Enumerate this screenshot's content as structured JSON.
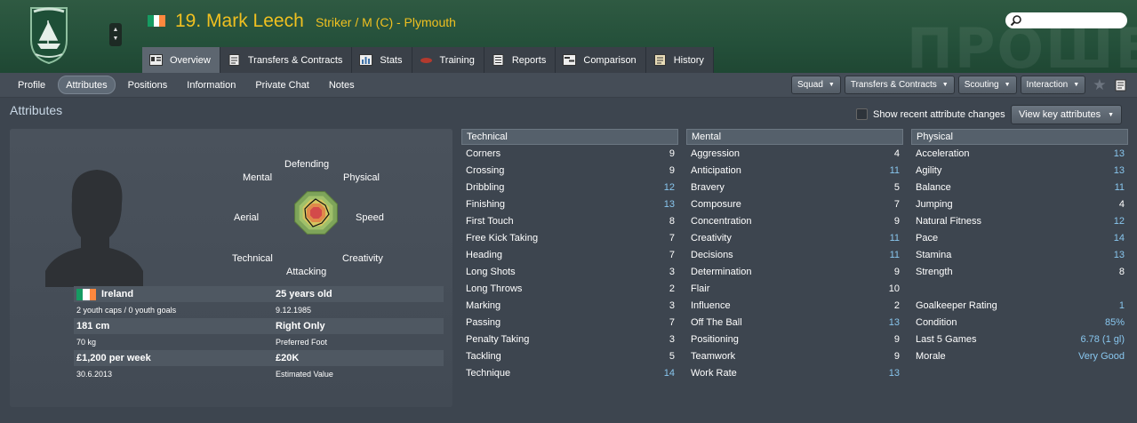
{
  "header": {
    "player_name": "19. Mark Leech",
    "player_role": "Striker / M (C) - Plymouth",
    "watermark": "ПРОШЕ",
    "search": {
      "placeholder": ""
    },
    "flag_colors": [
      "#169b62",
      "#ffffff",
      "#ff883e"
    ]
  },
  "tabs": [
    {
      "label": "Overview",
      "icon": "overview-icon",
      "active": true
    },
    {
      "label": "Transfers & Contracts",
      "icon": "document-icon"
    },
    {
      "label": "Stats",
      "icon": "stats-icon"
    },
    {
      "label": "Training",
      "icon": "training-icon"
    },
    {
      "label": "Reports",
      "icon": "report-icon"
    },
    {
      "label": "Comparison",
      "icon": "comparison-icon"
    },
    {
      "label": "History",
      "icon": "history-icon"
    }
  ],
  "subnav": [
    "Profile",
    "Attributes",
    "Positions",
    "Information",
    "Private Chat",
    "Notes"
  ],
  "subnav_active": "Attributes",
  "dropdowns": [
    "Squad",
    "Transfers & Contracts",
    "Scouting",
    "Interaction"
  ],
  "section_title": "Attributes",
  "show_recent_label": "Show recent attribute changes",
  "view_key_label": "View key attributes",
  "radar": {
    "labels": {
      "defending": "Defending",
      "physical": "Physical",
      "speed": "Speed",
      "creativity": "Creativity",
      "attacking": "Attacking",
      "technical": "Technical",
      "aerial": "Aerial",
      "mental": "Mental"
    }
  },
  "profile": {
    "nationality": "Ireland",
    "caps": "2 youth caps / 0 youth goals",
    "age": "25 years old",
    "dob": "9.12.1985",
    "height": "181 cm",
    "weight": "70 kg",
    "foot": "Right Only",
    "foot_label": "Preferred Foot",
    "wage": "£1,200 per week",
    "contract_end": "30.6.2013",
    "value": "£20K",
    "value_label": "Estimated Value"
  },
  "technical": {
    "title": "Technical",
    "items": [
      {
        "name": "Corners",
        "value": "9",
        "color": "white"
      },
      {
        "name": "Crossing",
        "value": "9",
        "color": "white"
      },
      {
        "name": "Dribbling",
        "value": "12",
        "color": "blue"
      },
      {
        "name": "Finishing",
        "value": "13",
        "color": "blue"
      },
      {
        "name": "First Touch",
        "value": "8",
        "color": "white"
      },
      {
        "name": "Free Kick Taking",
        "value": "7",
        "color": "white"
      },
      {
        "name": "Heading",
        "value": "7",
        "color": "white"
      },
      {
        "name": "Long Shots",
        "value": "3",
        "color": "white"
      },
      {
        "name": "Long Throws",
        "value": "2",
        "color": "white"
      },
      {
        "name": "Marking",
        "value": "3",
        "color": "white"
      },
      {
        "name": "Passing",
        "value": "7",
        "color": "white"
      },
      {
        "name": "Penalty Taking",
        "value": "3",
        "color": "white"
      },
      {
        "name": "Tackling",
        "value": "5",
        "color": "white"
      },
      {
        "name": "Technique",
        "value": "14",
        "color": "blue"
      }
    ]
  },
  "mental": {
    "title": "Mental",
    "items": [
      {
        "name": "Aggression",
        "value": "4",
        "color": "white"
      },
      {
        "name": "Anticipation",
        "value": "11",
        "color": "blue"
      },
      {
        "name": "Bravery",
        "value": "5",
        "color": "white"
      },
      {
        "name": "Composure",
        "value": "7",
        "color": "white"
      },
      {
        "name": "Concentration",
        "value": "9",
        "color": "white"
      },
      {
        "name": "Creativity",
        "value": "11",
        "color": "blue"
      },
      {
        "name": "Decisions",
        "value": "11",
        "color": "blue"
      },
      {
        "name": "Determination",
        "value": "9",
        "color": "white"
      },
      {
        "name": "Flair",
        "value": "10",
        "color": "white"
      },
      {
        "name": "Influence",
        "value": "2",
        "color": "white"
      },
      {
        "name": "Off The Ball",
        "value": "13",
        "color": "blue"
      },
      {
        "name": "Positioning",
        "value": "9",
        "color": "white"
      },
      {
        "name": "Teamwork",
        "value": "9",
        "color": "white"
      },
      {
        "name": "Work Rate",
        "value": "13",
        "color": "blue"
      }
    ]
  },
  "physical": {
    "title": "Physical",
    "items": [
      {
        "name": "Acceleration",
        "value": "13",
        "color": "blue"
      },
      {
        "name": "Agility",
        "value": "13",
        "color": "blue"
      },
      {
        "name": "Balance",
        "value": "11",
        "color": "blue"
      },
      {
        "name": "Jumping",
        "value": "4",
        "color": "white"
      },
      {
        "name": "Natural Fitness",
        "value": "12",
        "color": "blue"
      },
      {
        "name": "Pace",
        "value": "14",
        "color": "blue"
      },
      {
        "name": "Stamina",
        "value": "13",
        "color": "blue"
      },
      {
        "name": "Strength",
        "value": "8",
        "color": "white"
      },
      {
        "name": "",
        "value": "",
        "color": "white"
      },
      {
        "name": "Goalkeeper Rating",
        "value": "1",
        "color": "blue"
      },
      {
        "name": "Condition",
        "value": "85%",
        "color": "blue"
      },
      {
        "name": "Last 5 Games",
        "value": "6.78 (1 gl)",
        "color": "blue"
      },
      {
        "name": "Morale",
        "value": "Very Good",
        "color": "blue"
      }
    ]
  }
}
